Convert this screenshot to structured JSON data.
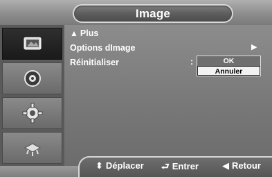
{
  "header": {
    "title": "Image"
  },
  "sidebar": {
    "items": [
      {
        "icon": "picture-icon",
        "active": true
      },
      {
        "icon": "sound-icon",
        "active": false
      },
      {
        "icon": "setup-gear-icon",
        "active": false
      },
      {
        "icon": "input-icon",
        "active": false
      }
    ]
  },
  "menu": {
    "items": [
      {
        "prefix": "▲",
        "label": "Plus"
      },
      {
        "label": "Options dImage",
        "arrow": "▶"
      },
      {
        "label": "Réinitialiser",
        "colon": ":"
      }
    ],
    "dropdown": {
      "options": [
        {
          "label": "OK",
          "selected": false
        },
        {
          "label": "Annuler",
          "selected": true
        }
      ]
    }
  },
  "footer": {
    "move": {
      "icon": "⬍",
      "label": "Déplacer"
    },
    "enter": {
      "icon": "⮐",
      "label": "Entrer"
    },
    "back": {
      "icon": "◀",
      "label": "Retour"
    }
  },
  "colors": {
    "panel": "#777777",
    "sidebar_active": "#1a1a1a",
    "selected_option": "#f2f2f2",
    "text": "#ffffff"
  }
}
